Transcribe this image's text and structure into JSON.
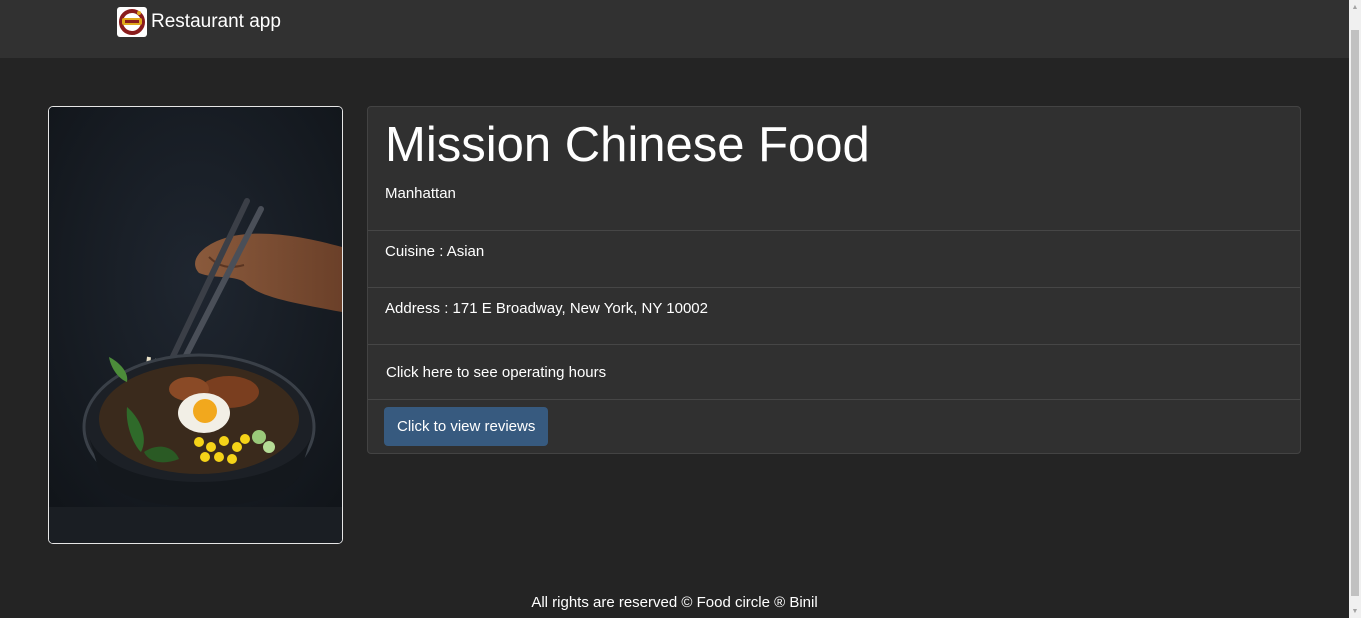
{
  "navbar": {
    "logo_icon": "restaurant-logo-icon",
    "brand_name": "Restaurant app"
  },
  "restaurant": {
    "photo": "ramen-bowl-with-chopsticks-photo",
    "name": "Mission Chinese Food",
    "neighborhood": "Manhattan",
    "cuisine_text": "Cuisine : Asian",
    "address_text": "Address : 171 E Broadway, New York, NY 10002",
    "hours_link": "Click here to see operating hours",
    "reviews_button": "Click to view reviews"
  },
  "footer": {
    "text": "All rights are reserved © Food circle ® Binil"
  },
  "colors": {
    "page_background": "#242424",
    "navbar_background": "#313131",
    "card_background": "#303030",
    "button_primary": "#375a7f",
    "text": "#ffffff"
  }
}
